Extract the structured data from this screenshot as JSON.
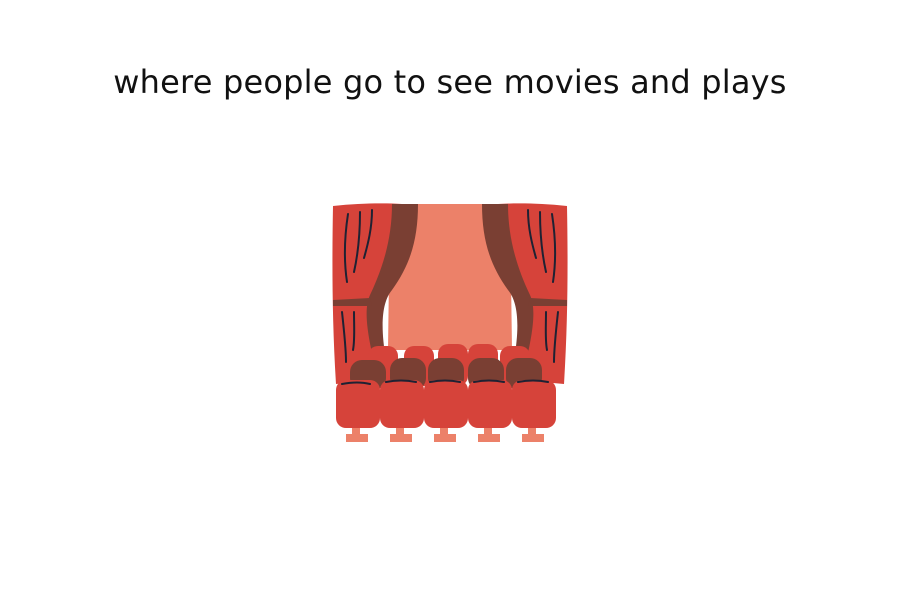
{
  "caption": "where people go to see movies and plays",
  "illustration": {
    "icon": "theater-stage-with-seats",
    "colors": {
      "stage_backdrop": "#ec8169",
      "curtain": "#d6433a",
      "curtain_inner_fold": "#7a3f33",
      "curtain_line": "#1e2233",
      "seat_back_row": "#d6433a",
      "seat_front_row": "#d6433a",
      "seat_shadow": "#7a3f33",
      "seat_leg": "#ec8169"
    }
  }
}
